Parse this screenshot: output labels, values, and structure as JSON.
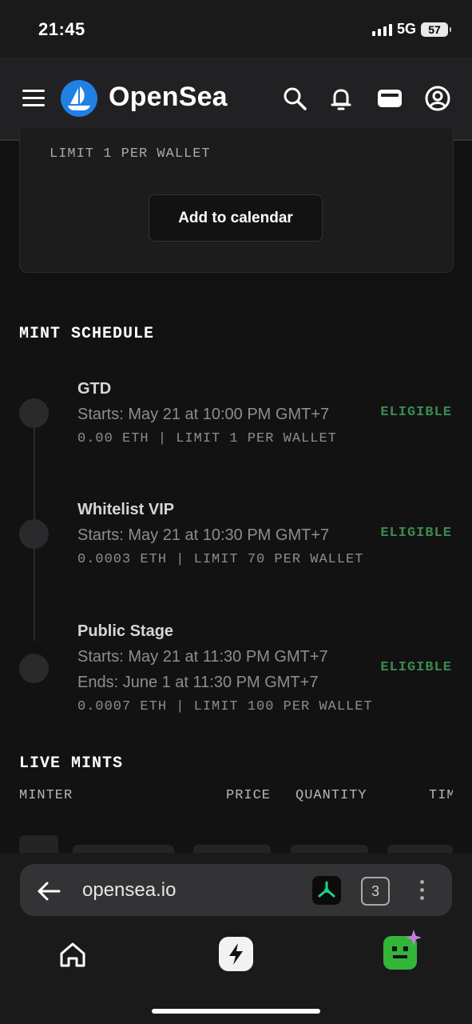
{
  "status_bar": {
    "time": "21:45",
    "network": "5G",
    "battery": "57"
  },
  "header": {
    "brand": "OpenSea"
  },
  "card": {
    "limit_text": "LIMIT 1 PER WALLET",
    "calendar_button": "Add to calendar"
  },
  "mint_schedule": {
    "title": "MINT SCHEDULE",
    "stages": [
      {
        "name": "GTD",
        "starts": "Starts: May 21 at 10:00 PM GMT+7",
        "meta": "0.00 ETH | LIMIT 1 PER WALLET",
        "status": "ELIGIBLE"
      },
      {
        "name": "Whitelist VIP",
        "starts": "Starts: May 21 at 10:30 PM GMT+7",
        "meta": "0.0003 ETH | LIMIT 70 PER WALLET",
        "status": "ELIGIBLE"
      },
      {
        "name": "Public Stage",
        "starts": "Starts: May 21 at 11:30 PM GMT+7",
        "ends": "Ends: June 1 at 11:30 PM GMT+7",
        "meta": "0.0007 ETH | LIMIT 100 PER WALLET",
        "status": "ELIGIBLE"
      }
    ]
  },
  "live_mints": {
    "title": "LIVE MINTS",
    "columns": [
      "MINTER",
      "PRICE",
      "QUANTITY",
      "TIM"
    ]
  },
  "browser": {
    "url": "opensea.io",
    "tab_count": "3"
  },
  "colors": {
    "eligible": "#3d8a4f",
    "opensea_blue": "#2081e2",
    "background": "#121212"
  }
}
